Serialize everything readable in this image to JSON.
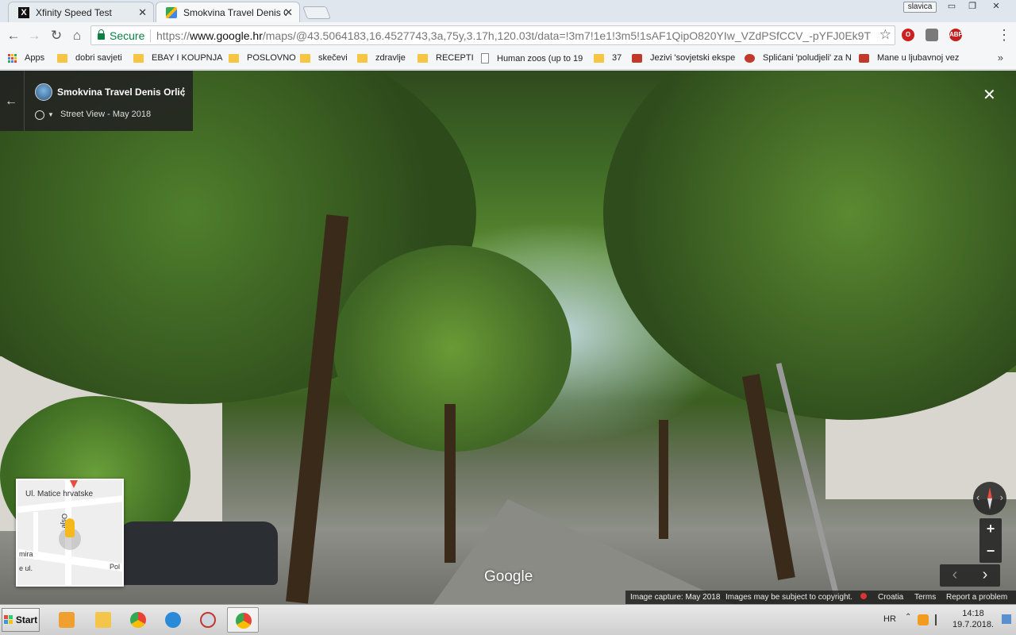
{
  "browser": {
    "tabs": [
      {
        "title": "Xfinity Speed Test",
        "active": false,
        "favicon": "xfinity-x-icon"
      },
      {
        "title": "Smokvina Travel Denis Orlić",
        "active": true,
        "favicon": "google-maps-icon"
      }
    ],
    "user": "slavica",
    "window_controls": {
      "minimize": "▭",
      "restore": "❐",
      "close": "✕"
    },
    "toolbar": {
      "secure_label": "Secure",
      "url_scheme": "https://",
      "url_host": "www.google.hr",
      "url_path": "/maps/@43.5064183,16.4527743,3a,75y,3.17h,120.03t/data=!3m7!1e1!3m5!1sAF1QipO820YIw_VZdPSfCCV_-pYFJ0Ek9TKWsrE...",
      "abp_label": "ABP"
    },
    "bookmarks": [
      {
        "label": "Apps",
        "icon": "apps-grid-icon"
      },
      {
        "label": "dobri savjeti",
        "icon": "folder-icon"
      },
      {
        "label": "EBAY I KOUPNJA",
        "icon": "folder-icon"
      },
      {
        "label": "POSLOVNO",
        "icon": "folder-icon"
      },
      {
        "label": "skečevi",
        "icon": "folder-icon"
      },
      {
        "label": "zdravlje",
        "icon": "folder-icon"
      },
      {
        "label": "RECEPTI",
        "icon": "folder-icon"
      },
      {
        "label": "Human zoos (up to 19",
        "icon": "page-icon"
      },
      {
        "label": "37",
        "icon": "folder-icon"
      },
      {
        "label": "Jezivi 'sovjetski ekspe",
        "icon": "site-favicon"
      },
      {
        "label": "Splićani 'poludjeli' za N",
        "icon": "sd-favicon"
      },
      {
        "label": "Mane u ljubavnoj vez",
        "icon": "site-favicon"
      }
    ],
    "bookmarks_more": "»"
  },
  "streetview": {
    "place_name": "Smokvina Travel Denis Orlić",
    "date_label": "Street View - May 2018",
    "minimap": {
      "streets": [
        "Ul. Matice hrvatske",
        "Osje",
        "mira",
        "e ul.",
        "Pol"
      ]
    },
    "logo": "Google",
    "footer": {
      "capture": "Image capture: May 2018",
      "copyright": "Images may be subject to copyright.",
      "country": "Croatia",
      "terms": "Terms",
      "report": "Report a problem"
    },
    "zoom_in": "+",
    "zoom_out": "−",
    "prev": "‹",
    "next": "›"
  },
  "taskbar": {
    "start_label": "Start",
    "language": "HR",
    "time": "14:18",
    "date": "19.7.2018."
  }
}
